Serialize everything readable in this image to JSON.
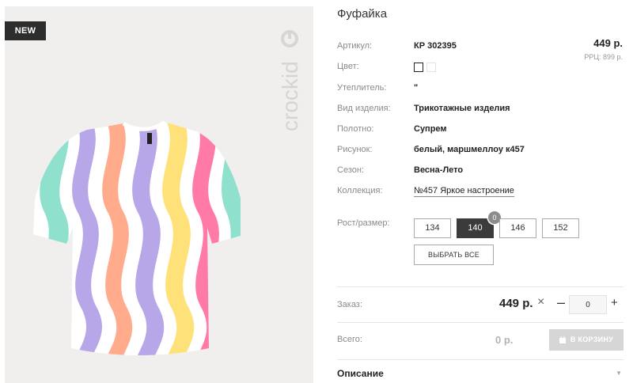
{
  "gallery": {
    "badge": "NEW",
    "brand": "crockid"
  },
  "product": {
    "title": "Фуфайка",
    "price": "449 р.",
    "rrc": "РРЦ: 899 р.",
    "attributes": [
      {
        "label": "Артикул:",
        "value": "КР 302395"
      },
      {
        "label": "Цвет:",
        "value": ""
      },
      {
        "label": "Утеплитель:",
        "value": "\""
      },
      {
        "label": "Вид изделия:",
        "value": "Трикотажные изделия"
      },
      {
        "label": "Полотно:",
        "value": "Супрем"
      },
      {
        "label": "Рисунок:",
        "value": "белый, маршмеллоу к457"
      },
      {
        "label": "Сезон:",
        "value": "Весна-Лето"
      },
      {
        "label": "Коллекция:",
        "value": "№457 Яркое настроение"
      }
    ],
    "colors": [
      "#ffffff",
      "#ffffff"
    ]
  },
  "sizes": {
    "label": "Рост/размер:",
    "options": [
      "134",
      "140",
      "146",
      "152"
    ],
    "active": "140",
    "active_count": "0",
    "select_all": "ВЫБРАТЬ ВСЕ"
  },
  "order": {
    "label": "Заказ:",
    "price": "449 р.",
    "times": "×",
    "minus": "–",
    "qty": "0",
    "plus": "+"
  },
  "total": {
    "label": "Всего:",
    "value": "0 р.",
    "cart_button": "В КОРЗИНУ"
  },
  "description": {
    "title": "Описание",
    "chevron": "▼"
  }
}
